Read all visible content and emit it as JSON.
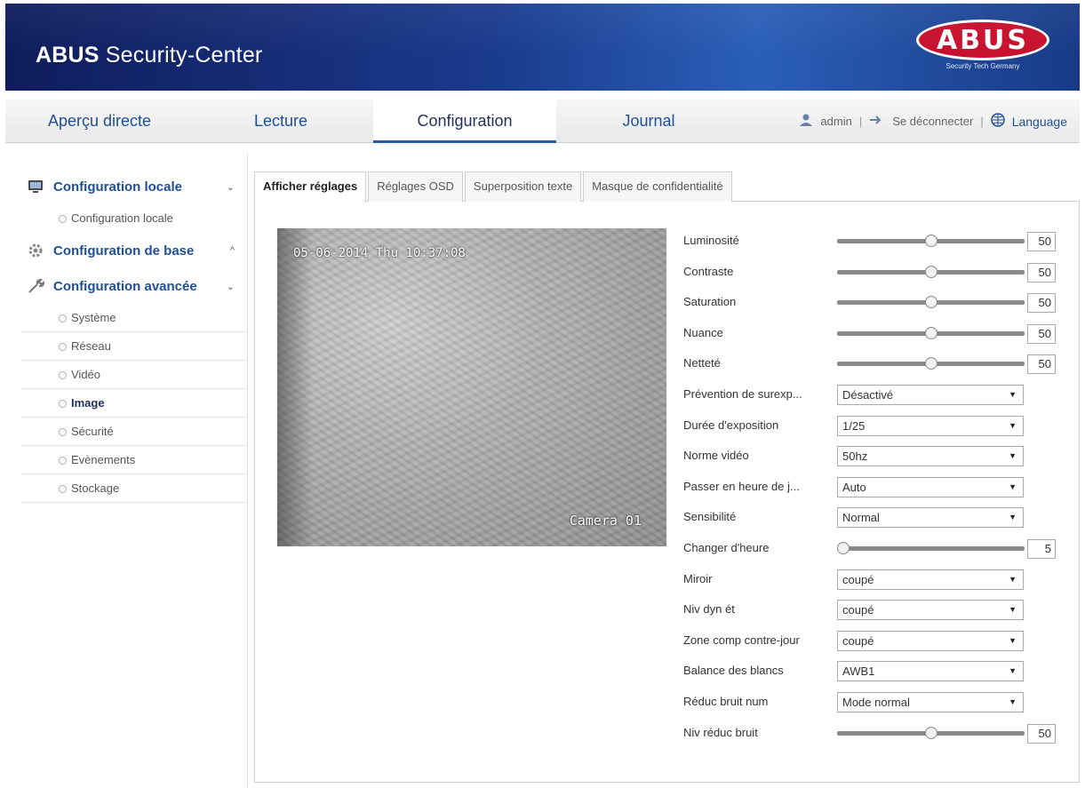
{
  "header": {
    "title_bold": "ABUS",
    "title_rest": " Security-Center",
    "logo_text": "ABUS",
    "logo_sub": "Security Tech Germany"
  },
  "nav": {
    "tabs": [
      "Aperçu directe",
      "Lecture",
      "Configuration",
      "Journal"
    ],
    "active": "Configuration",
    "user": "admin",
    "separator": "|",
    "logout": "Se déconnecter",
    "language": "Language"
  },
  "sidebar": {
    "local": {
      "label": "Configuration locale",
      "chev": "⌄",
      "items": [
        "Configuration locale"
      ]
    },
    "base": {
      "label": "Configuration de base",
      "chev": "^"
    },
    "advanced": {
      "label": "Configuration avancée",
      "chev": "⌄",
      "items": [
        "Système",
        "Réseau",
        "Vidéo",
        "Image",
        "Sécurité",
        "Evènements",
        "Stockage"
      ],
      "active": "Image"
    }
  },
  "tabs": [
    "Afficher réglages",
    "Réglages OSD",
    "Superposition texte",
    "Masque de confidentialité"
  ],
  "preview": {
    "date_text": "05-06-2014 Thu 10:37:08",
    "camera_name": "Camera 01"
  },
  "settings": {
    "brightness": {
      "label": "Luminosité",
      "value": "50",
      "level": 0.5
    },
    "contrast": {
      "label": "Contraste",
      "value": "50",
      "level": 0.5
    },
    "saturation": {
      "label": "Saturation",
      "value": "50",
      "level": 0.5
    },
    "hue": {
      "label": "Nuance",
      "value": "50",
      "level": 0.5
    },
    "sharpness": {
      "label": "Netteté",
      "value": "50",
      "level": 0.5
    },
    "overexposure": {
      "label": "Prévention de surexp...",
      "value": "Désactivé"
    },
    "exposure_time": {
      "label": "Durée d'exposition",
      "value": "1/25"
    },
    "video_standard": {
      "label": "Norme vidéo",
      "value": "50hz"
    },
    "day_night": {
      "label": "Passer en heure de j...",
      "value": "Auto"
    },
    "sensitivity": {
      "label": "Sensibilité",
      "value": "Normal"
    },
    "switch_time": {
      "label": "Changer d'heure",
      "value": "5",
      "level": 0.0
    },
    "mirror": {
      "label": "Miroir",
      "value": "coupé"
    },
    "wdr": {
      "label": "Niv dyn ét",
      "value": "coupé"
    },
    "blc": {
      "label": "Zone comp contre-jour",
      "value": "coupé"
    },
    "white_balance": {
      "label": "Balance des blancs",
      "value": "AWB1"
    },
    "dnr": {
      "label": "Réduc bruit num",
      "value": "Mode normal"
    },
    "dnr_level": {
      "label": "Niv réduc bruit",
      "value": "50",
      "level": 0.5
    }
  },
  "colors": {
    "accent": "#1f4f94",
    "banner": "#1a3a8c",
    "logo_red": "#c8102e"
  }
}
